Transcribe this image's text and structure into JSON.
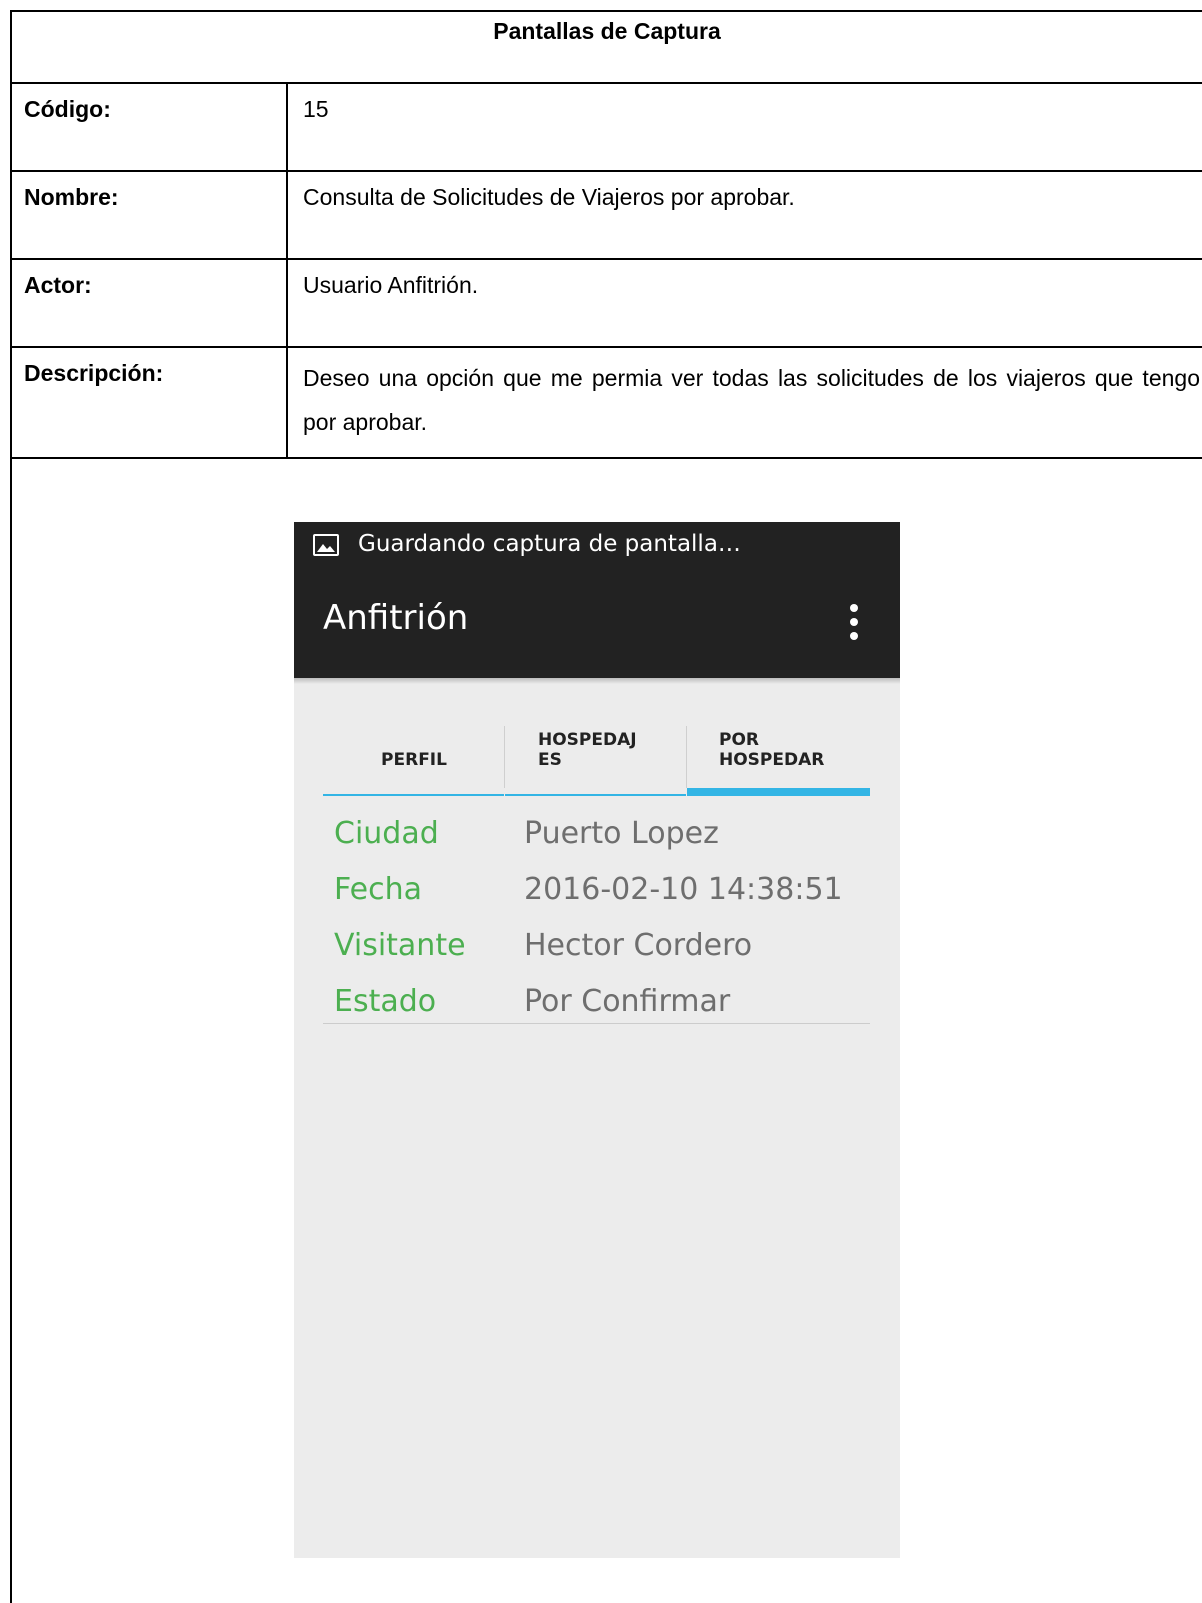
{
  "document": {
    "title": "Pantallas de Captura",
    "fields": [
      {
        "label": "Código:",
        "value": "15"
      },
      {
        "label": "Nombre:",
        "value": "Consulta de Solicitudes de Viajeros por aprobar."
      },
      {
        "label": "Actor:",
        "value": "Usuario Anfitrión."
      },
      {
        "label": "Descripción:",
        "value": "Deseo una opción que me permia ver todas las solicitudes de los viajeros que tengo por aprobar."
      }
    ]
  },
  "phone": {
    "status_bar": {
      "text": "Guardando captura de pantalla…",
      "icon": "image-icon"
    },
    "action_bar": {
      "title": "Anfitrión",
      "menu_icon": "overflow-menu-icon"
    },
    "tabs": [
      {
        "label": "PERFIL",
        "selected": false
      },
      {
        "label": "HOSPEDAJ\nES",
        "selected": false
      },
      {
        "label": "POR\nHOSPEDAR",
        "selected": true
      }
    ],
    "details": [
      {
        "label": "Ciudad",
        "value": "Puerto Lopez"
      },
      {
        "label": "Fecha",
        "value": "2016-02-10 14:38:51"
      },
      {
        "label": "Visitante",
        "value": "Hector Cordero"
      },
      {
        "label": "Estado",
        "value": "Por Confirmar"
      }
    ],
    "colors": {
      "bar_background": "#222222",
      "tab_indicator": "#33b5e5",
      "label_green": "#4caf50",
      "value_gray": "#6e6e6e",
      "screen_background": "#ececec"
    }
  }
}
